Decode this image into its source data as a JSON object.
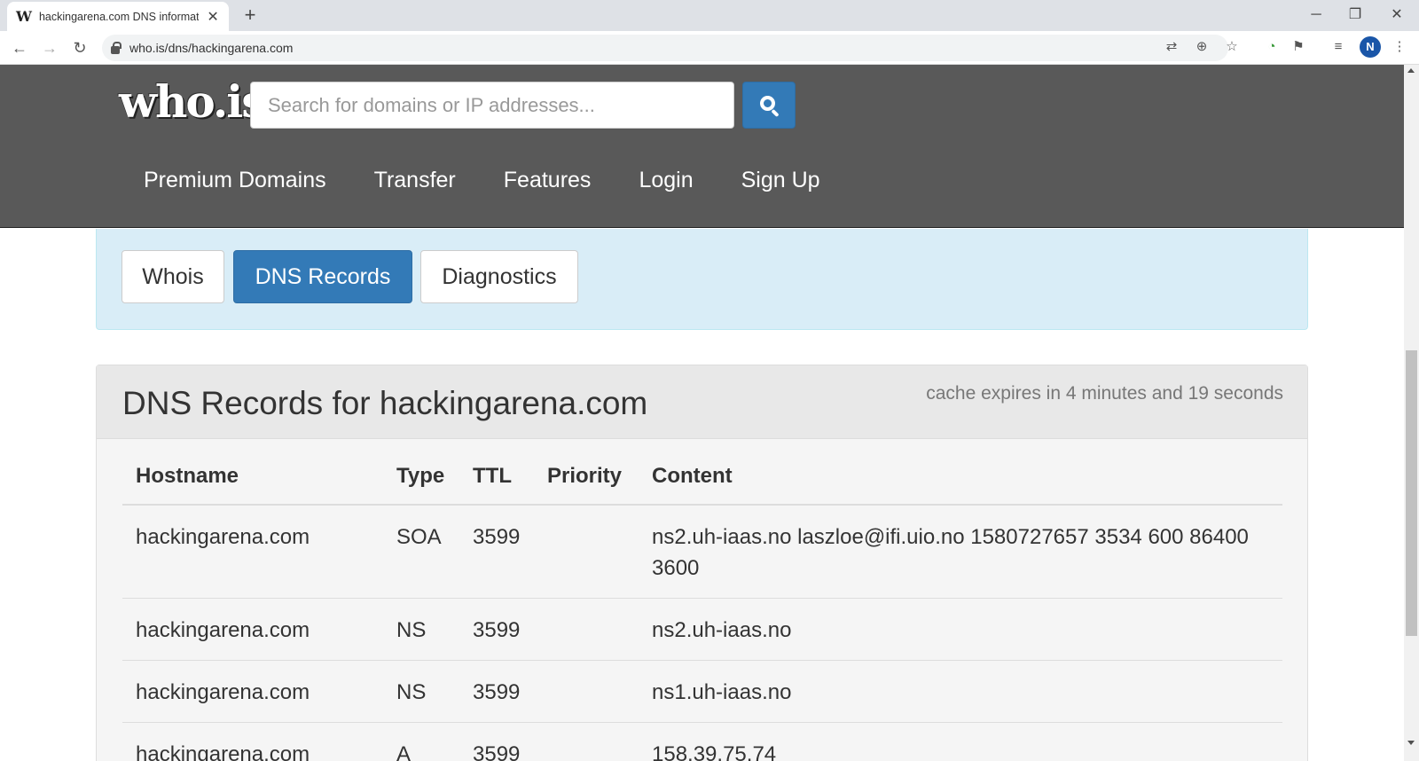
{
  "browser": {
    "tab_title": "hackingarena.com DNS informati",
    "favicon": "W",
    "new_tab": "+",
    "close_tab": "✕",
    "url": "who.is/dns/hackingarena.com",
    "profile_initial": "N",
    "window_controls": {
      "minimize": "─",
      "restore": "❐",
      "close": "✕"
    }
  },
  "site": {
    "logo": "who.is",
    "search": {
      "placeholder": "Search for domains or IP addresses...",
      "value": ""
    },
    "nav": [
      "Premium Domains",
      "Transfer",
      "Features",
      "Login",
      "Sign Up"
    ]
  },
  "tabs": [
    "Whois",
    "DNS Records",
    "Diagnostics"
  ],
  "active_tab": "DNS Records",
  "records": {
    "title": "DNS Records for hackingarena.com",
    "cache_note": "cache expires in 4 minutes and 19 seconds",
    "columns": [
      "Hostname",
      "Type",
      "TTL",
      "Priority",
      "Content"
    ],
    "rows": [
      {
        "hostname": "hackingarena.com",
        "type": "SOA",
        "ttl": "3599",
        "priority": "",
        "content": "ns2.uh-iaas.no laszloe@ifi.uio.no 1580727657 3534 600 86400 3600"
      },
      {
        "hostname": "hackingarena.com",
        "type": "NS",
        "ttl": "3599",
        "priority": "",
        "content": "ns2.uh-iaas.no"
      },
      {
        "hostname": "hackingarena.com",
        "type": "NS",
        "ttl": "3599",
        "priority": "",
        "content": "ns1.uh-iaas.no"
      },
      {
        "hostname": "hackingarena.com",
        "type": "A",
        "ttl": "3599",
        "priority": "",
        "content": "158.39.75.74"
      }
    ]
  },
  "colors": {
    "header_bg": "#595959",
    "primary": "#337ab7",
    "panel_bg": "#d9edf7"
  }
}
